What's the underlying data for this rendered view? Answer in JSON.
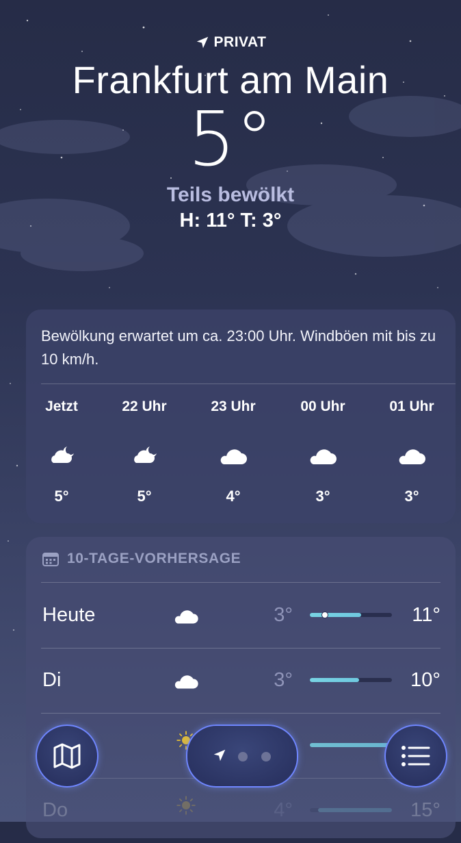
{
  "header": {
    "location_label": "PRIVAT",
    "city": "Frankfurt am Main",
    "temperature": "5°",
    "condition": "Teils bewölkt",
    "high_low": "H: 11°  T: 3°"
  },
  "hourly": {
    "summary": "Bewölkung erwartet um ca. 23:00 Uhr. Windböen mit bis zu 10 km/h.",
    "items": [
      {
        "time": "Jetzt",
        "icon": "cloud-moon-icon",
        "temp": "5°"
      },
      {
        "time": "22 Uhr",
        "icon": "cloud-moon-icon",
        "temp": "5°"
      },
      {
        "time": "23 Uhr",
        "icon": "cloud-icon",
        "temp": "4°"
      },
      {
        "time": "00 Uhr",
        "icon": "cloud-icon",
        "temp": "3°"
      },
      {
        "time": "01 Uhr",
        "icon": "cloud-icon",
        "temp": "3°"
      }
    ]
  },
  "daily": {
    "title": "10-TAGE-VORHERSAGE",
    "days": [
      {
        "day": "Heute",
        "icon": "cloud-icon",
        "low": "3°",
        "high": "11°",
        "range_start": 0.0,
        "range_end": 0.625,
        "current": 0.18
      },
      {
        "day": "Di",
        "icon": "cloud-icon",
        "low": "3°",
        "high": "10°",
        "range_start": 0.0,
        "range_end": 0.6
      },
      {
        "day": "",
        "icon": "sun-icon",
        "low": "",
        "high": "",
        "range_start": 0.0,
        "range_end": 1.0
      },
      {
        "day": "Do",
        "icon": "sun-icon",
        "low": "4°",
        "high": "15°",
        "range_start": 0.1,
        "range_end": 1.0
      }
    ]
  },
  "toolbar": {
    "map_icon": "map-icon",
    "location_arrow_icon": "location-arrow-icon",
    "list_icon": "list-icon",
    "page_count": 3,
    "active_page": 0
  },
  "colors": {
    "accent_bar": "#78d4e3",
    "toolbar_ring": "#6f86ff",
    "condition_text": "#b9bde0"
  }
}
